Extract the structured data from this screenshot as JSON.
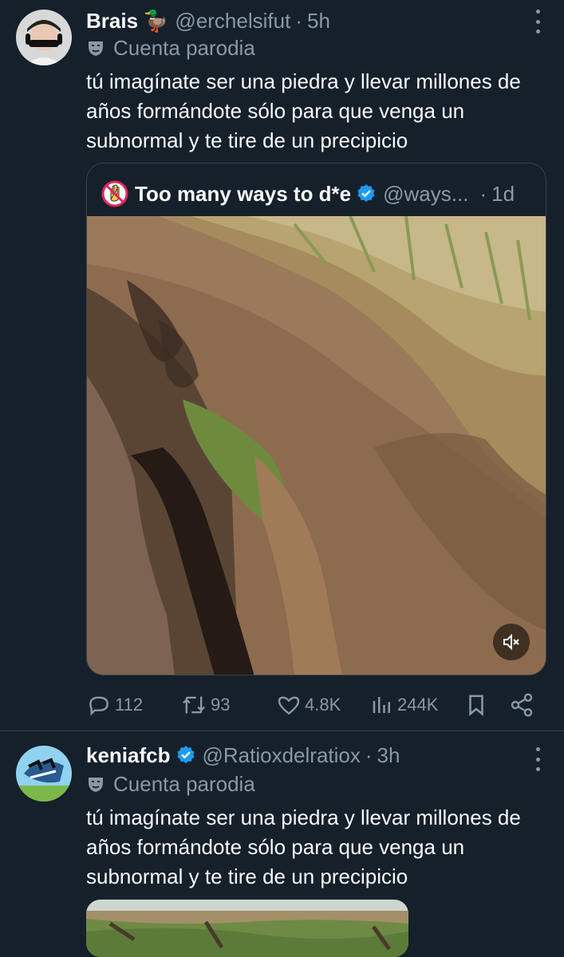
{
  "tweets": [
    {
      "display_name": "Brais",
      "name_emoji": "🦆",
      "handle": "@erchelsifut",
      "time": "5h",
      "parody_label": "Cuenta parodia",
      "text": "tú imagínate ser una piedra y llevar millones de años formándote sólo para que venga un subnormal y te tire de un precipicio",
      "quote": {
        "display_name": "Too many ways to d*e",
        "handle": "@ways...",
        "time": "1d"
      },
      "actions": {
        "replies": "112",
        "reposts": "93",
        "likes": "4.8K",
        "views": "244K"
      }
    },
    {
      "display_name": "keniafcb",
      "handle": "@Ratioxdelratiox",
      "time": "3h",
      "parody_label": "Cuenta parodia",
      "text": "tú imagínate ser una piedra y llevar millones de años formándote sólo para que venga un subnormal y te tire de un precipicio"
    }
  ],
  "colors": {
    "background": "#15202b",
    "text_primary": "#f7f9f9",
    "text_secondary": "#8b98a5",
    "verified_blue": "#1d9bf0",
    "border": "#38444d"
  },
  "icons": [
    "more-icon",
    "parody-mask-icon",
    "verified-icon",
    "reply-icon",
    "repost-icon",
    "like-icon",
    "views-icon",
    "bookmark-icon",
    "share-icon",
    "mute-icon",
    "no-entry-hand-icon"
  ]
}
